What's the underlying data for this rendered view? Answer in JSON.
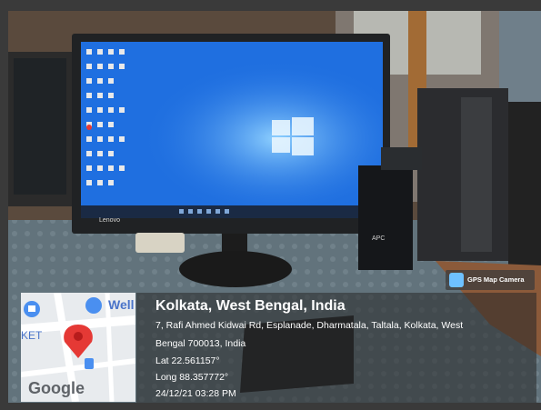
{
  "overlay": {
    "title": "Kolkata, West Bengal, India",
    "address_line1": "7, Rafi Ahmed Kidwai Rd, Esplanade, Dharmatala, Taltala, Kolkata, West",
    "address_line2": "Bengal 700013, India",
    "latitude": "Lat 22.561157°",
    "longitude": "Long 88.357772°",
    "timestamp": "24/12/21 03:28 PM"
  },
  "map": {
    "label_well": "Well",
    "label_ket": "KET",
    "brand": "Google"
  },
  "badge": {
    "label": "GPS Map Camera"
  },
  "monitor": {
    "brand": "Lenovo"
  },
  "ups": {
    "brand": "APC"
  },
  "colors": {
    "desktop_blue": "#1f6fe0",
    "overlay_bg": "#282828",
    "map_pin": "#e53935"
  }
}
